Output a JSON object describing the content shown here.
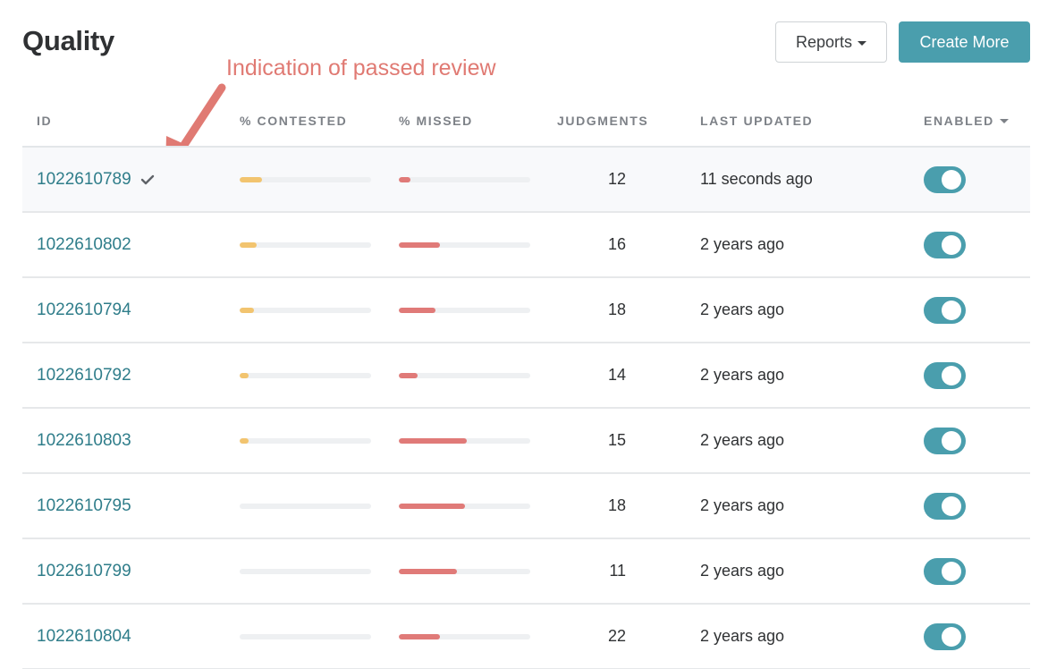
{
  "header": {
    "title": "Quality",
    "reports_label": "Reports",
    "create_label": "Create More"
  },
  "annotation": {
    "text": "Indication of passed review",
    "color": "#e07a73"
  },
  "colors": {
    "accent": "#4a9ead",
    "link": "#2f7d8a",
    "contested_bar": "#f2c46f",
    "missed_bar": "#e07a78"
  },
  "table": {
    "columns": {
      "id": "ID",
      "contested": "% CONTESTED",
      "missed": "% MISSED",
      "judgments": "JUDGMENTS",
      "updated": "LAST UPDATED",
      "enabled": "ENABLED"
    },
    "rows": [
      {
        "id": "1022610789",
        "passed_review": true,
        "contested_pct": 17,
        "missed_pct": 9,
        "judgments": "12",
        "updated": "11 seconds ago",
        "enabled": true
      },
      {
        "id": "1022610802",
        "passed_review": false,
        "contested_pct": 13,
        "missed_pct": 31,
        "judgments": "16",
        "updated": "2 years ago",
        "enabled": true
      },
      {
        "id": "1022610794",
        "passed_review": false,
        "contested_pct": 11,
        "missed_pct": 28,
        "judgments": "18",
        "updated": "2 years ago",
        "enabled": true
      },
      {
        "id": "1022610792",
        "passed_review": false,
        "contested_pct": 7,
        "missed_pct": 14,
        "judgments": "14",
        "updated": "2 years ago",
        "enabled": true
      },
      {
        "id": "1022610803",
        "passed_review": false,
        "contested_pct": 7,
        "missed_pct": 52,
        "judgments": "15",
        "updated": "2 years ago",
        "enabled": true
      },
      {
        "id": "1022610795",
        "passed_review": false,
        "contested_pct": 0,
        "missed_pct": 50,
        "judgments": "18",
        "updated": "2 years ago",
        "enabled": true
      },
      {
        "id": "1022610799",
        "passed_review": false,
        "contested_pct": 0,
        "missed_pct": 44,
        "judgments": "11",
        "updated": "2 years ago",
        "enabled": true
      },
      {
        "id": "1022610804",
        "passed_review": false,
        "contested_pct": 0,
        "missed_pct": 31,
        "judgments": "22",
        "updated": "2 years ago",
        "enabled": true
      }
    ]
  }
}
